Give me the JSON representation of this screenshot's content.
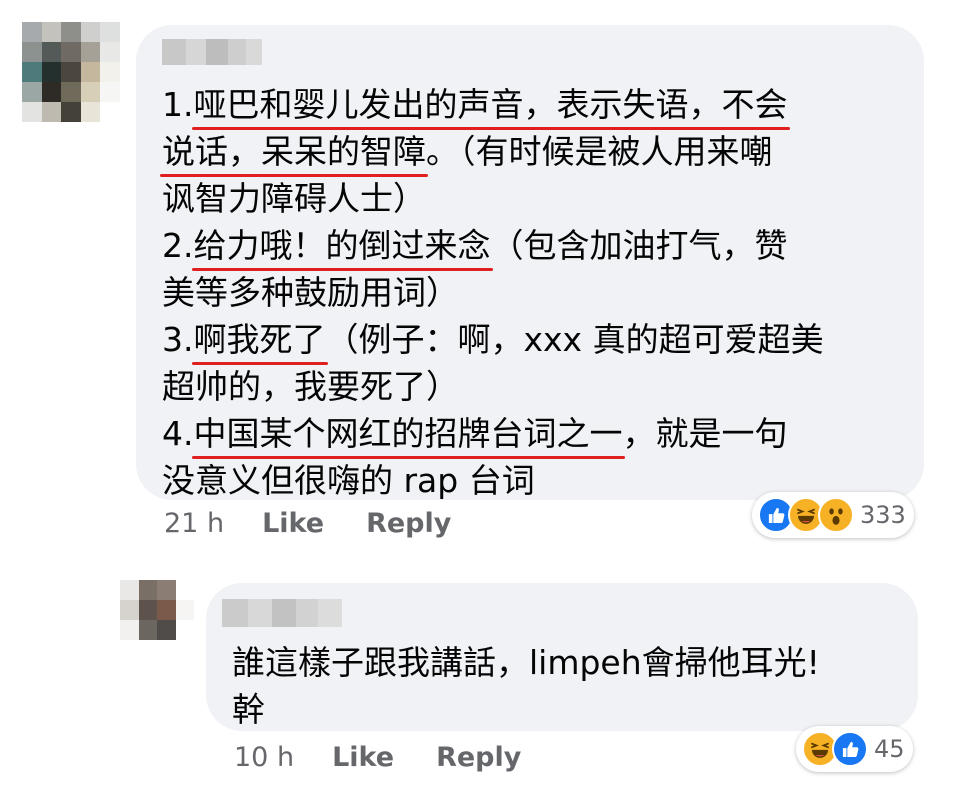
{
  "comments": [
    {
      "text_lines": [
        [
          "1.",
          {
            "u": "哑巴和婴儿发出的声音，表示失语，不会"
          }
        ],
        [
          {
            "u": "说话，呆呆的智障"
          },
          "。（有时候是被人用来嘲"
        ],
        [
          "讽智力障碍人士）"
        ],
        [
          "2.",
          {
            "u": "给力哦！的倒过来念"
          },
          "（包含加油打气，赞"
        ],
        [
          "美等多种鼓励用词）"
        ],
        [
          "3.",
          {
            "u": "啊我死了"
          },
          "（例子：啊，xxx 真的超可爱超美"
        ],
        [
          "超帅的，我要死了）"
        ],
        [
          "4.",
          {
            "u": "中国某个网红的招牌台词之一"
          },
          "，就是一句"
        ],
        [
          "没意义但很嗨的 rap 台词"
        ]
      ],
      "time": "21 h",
      "like_label": "Like",
      "reply_label": "Reply",
      "reactions": [
        "like-icon",
        "haha-icon",
        "wow-icon"
      ],
      "reaction_count": "333"
    },
    {
      "text_lines": [
        [
          "誰這樣子跟我講話，limpeh會掃他耳光!"
        ],
        [
          "幹"
        ]
      ],
      "time": "10 h",
      "like_label": "Like",
      "reply_label": "Reply",
      "reactions": [
        "haha-icon",
        "like-icon"
      ],
      "reaction_count": "45"
    }
  ],
  "colors": {
    "bubble": "#f0f2f5",
    "underline": "#e02020",
    "meta": "#65676b",
    "like": "#1877f2",
    "emoji": "#f7b125"
  }
}
